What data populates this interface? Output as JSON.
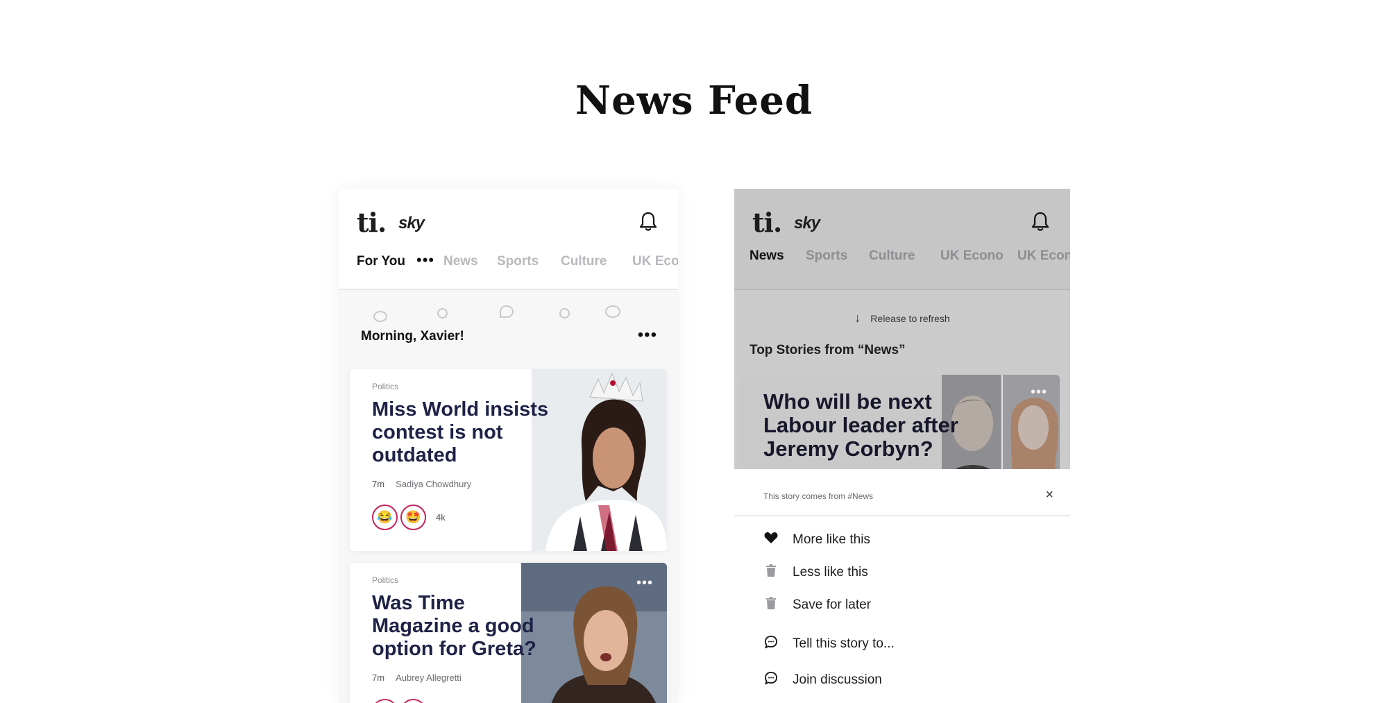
{
  "page": {
    "title": "News Feed"
  },
  "brand": {
    "logo_ti": "ti.",
    "logo_sky": "sky"
  },
  "feed_screen": {
    "tabs": [
      "For You",
      "News",
      "Sports",
      "Culture",
      "UK Econo"
    ],
    "active_tab": "For You",
    "greeting": "Morning, Xavier!",
    "cards": [
      {
        "category": "Politics",
        "title_lines": [
          "Miss World insists",
          "contest is not",
          "outdated"
        ],
        "time": "7m",
        "author": "Sadiya Chowdhury",
        "reactions": [
          "😂",
          "🤩"
        ],
        "reaction_count": "4k"
      },
      {
        "category": "Politics",
        "title_lines": [
          "Was Time",
          "Magazine a good",
          "option for Greta?"
        ],
        "time": "7m",
        "author": "Aubrey Allegretti"
      }
    ]
  },
  "menu_screen": {
    "tabs": [
      "News",
      "Sports",
      "Culture",
      "UK Econo",
      "UK Econo"
    ],
    "active_tab": "News",
    "refresh_text": "Release to refresh",
    "section_heading": "Top Stories from “News”",
    "story_title_lines": [
      "Who will be next",
      "Labour leader after",
      "Jeremy Corbyn?"
    ],
    "sheet": {
      "note": "This story comes from #News",
      "close_symbol": "×",
      "options": [
        {
          "label": "More like this",
          "icon": "heart-icon"
        },
        {
          "label": "Less like this",
          "icon": "trash-icon"
        },
        {
          "label": "Save for later",
          "icon": "trash-icon"
        },
        {
          "label": "Tell this story to...",
          "icon": "chat-icon"
        },
        {
          "label": "Join discussion",
          "icon": "chat-icon"
        }
      ]
    }
  },
  "colors": {
    "title_navy": "#1f2247",
    "reaction_ring": "#c2245e",
    "dim_overlay": "#cbcbcb"
  }
}
